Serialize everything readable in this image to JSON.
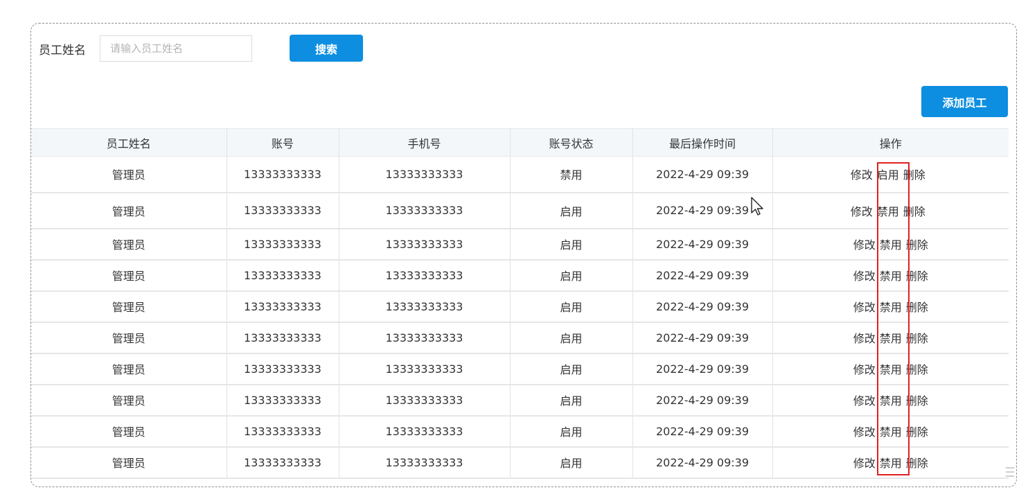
{
  "search": {
    "label": "员工姓名",
    "placeholder": "请输入员工姓名",
    "value": "",
    "button_label": "搜索"
  },
  "add_button_label": "添加员工",
  "table": {
    "columns": [
      "员工姓名",
      "账号",
      "手机号",
      "账号状态",
      "最后操作时间",
      "操作"
    ],
    "rows": [
      {
        "name": "管理员",
        "account": "13333333333",
        "phone": "13333333333",
        "status": "禁用",
        "time": "2022-4-29 09:39",
        "edit": "修改",
        "toggle": "启用",
        "delete": "删除"
      },
      {
        "name": "管理员",
        "account": "13333333333",
        "phone": "13333333333",
        "status": "启用",
        "time": "2022-4-29 09:39",
        "edit": "修改",
        "toggle": "禁用",
        "delete": "删除"
      },
      {
        "name": "管理员",
        "account": "13333333333",
        "phone": "13333333333",
        "status": "启用",
        "time": "2022-4-29 09:39",
        "edit": "修改",
        "toggle": "禁用",
        "delete": "删除"
      },
      {
        "name": "管理员",
        "account": "13333333333",
        "phone": "13333333333",
        "status": "启用",
        "time": "2022-4-29 09:39",
        "edit": "修改",
        "toggle": "禁用",
        "delete": "删除"
      },
      {
        "name": "管理员",
        "account": "13333333333",
        "phone": "13333333333",
        "status": "启用",
        "time": "2022-4-29 09:39",
        "edit": "修改",
        "toggle": "禁用",
        "delete": "删除"
      },
      {
        "name": "管理员",
        "account": "13333333333",
        "phone": "13333333333",
        "status": "启用",
        "time": "2022-4-29 09:39",
        "edit": "修改",
        "toggle": "禁用",
        "delete": "删除"
      },
      {
        "name": "管理员",
        "account": "13333333333",
        "phone": "13333333333",
        "status": "启用",
        "time": "2022-4-29 09:39",
        "edit": "修改",
        "toggle": "禁用",
        "delete": "删除"
      },
      {
        "name": "管理员",
        "account": "13333333333",
        "phone": "13333333333",
        "status": "启用",
        "time": "2022-4-29 09:39",
        "edit": "修改",
        "toggle": "禁用",
        "delete": "删除"
      },
      {
        "name": "管理员",
        "account": "13333333333",
        "phone": "13333333333",
        "status": "启用",
        "time": "2022-4-29 09:39",
        "edit": "修改",
        "toggle": "禁用",
        "delete": "删除"
      },
      {
        "name": "管理员",
        "account": "13333333333",
        "phone": "13333333333",
        "status": "启用",
        "time": "2022-4-29 09:39",
        "edit": "修改",
        "toggle": "禁用",
        "delete": "删除"
      }
    ]
  },
  "colors": {
    "primary_button": "#0d8ee0",
    "highlight_box": "#e02020",
    "header_background": "#f3f7fa"
  },
  "icons": {
    "cursor": "arrow-cursor-icon"
  }
}
